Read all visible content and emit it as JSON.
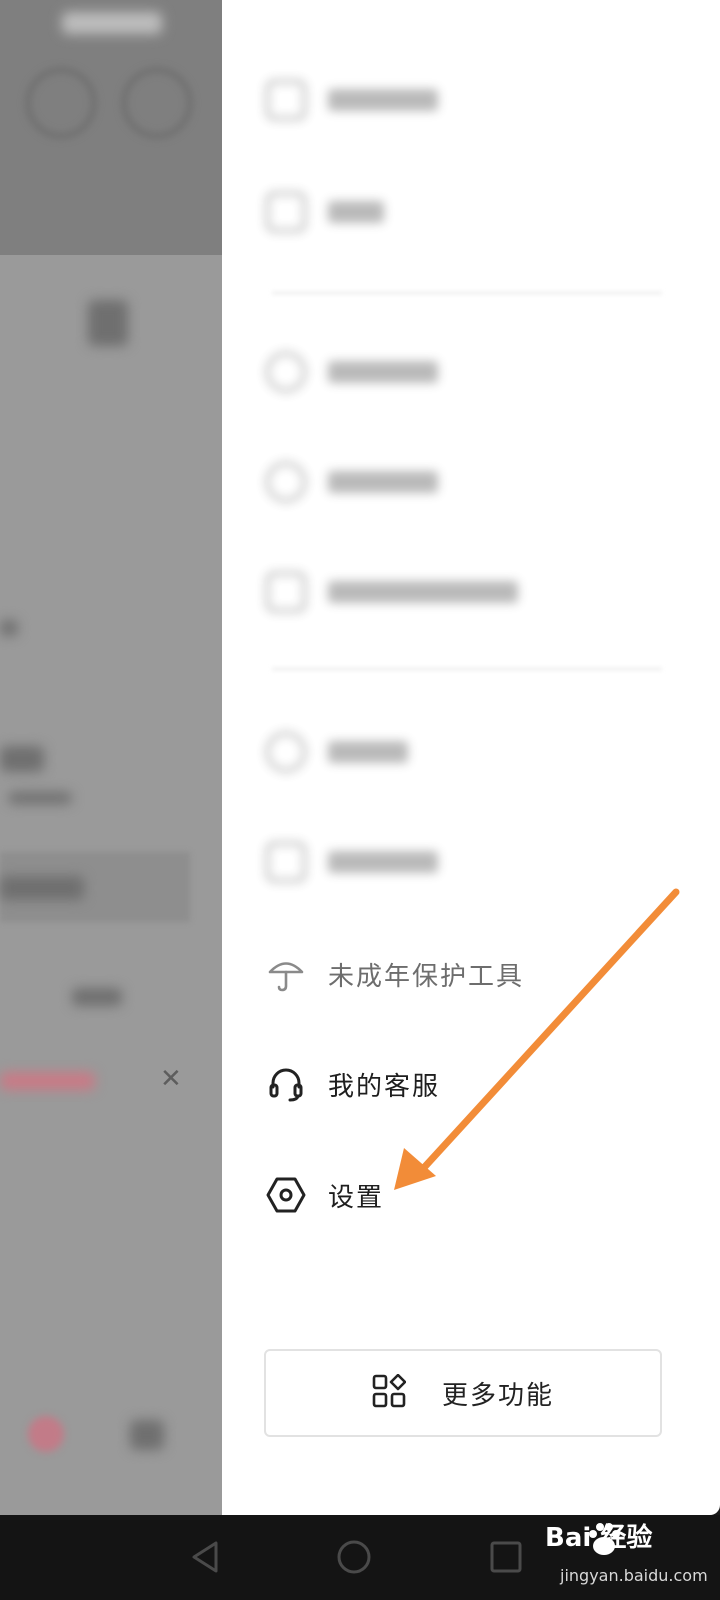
{
  "drawer": {
    "items_visible": [
      {
        "label": "未成年保护工具",
        "icon": "umbrella-icon",
        "dim": true
      },
      {
        "label": "我的客服",
        "icon": "headset-icon",
        "dim": false
      },
      {
        "label": "设置",
        "icon": "hexagon-settings-icon",
        "dim": false
      }
    ],
    "more_button_label": "更多功能"
  },
  "annotation": {
    "color": "#F28C38"
  },
  "watermark": {
    "brand": "Bai  经验",
    "url": "jingyan.baidu.com"
  }
}
